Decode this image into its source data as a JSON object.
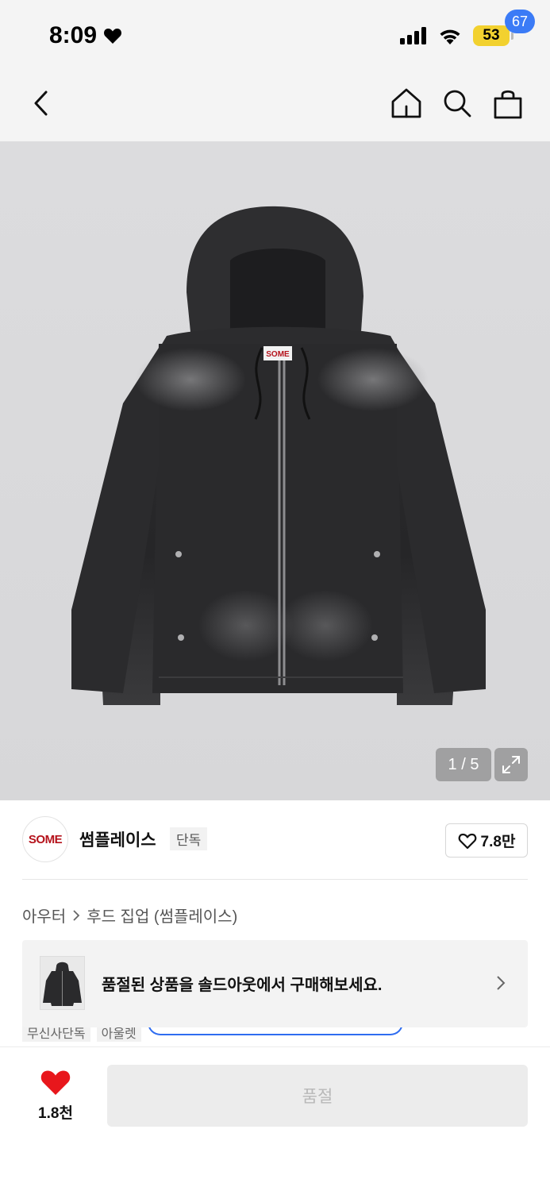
{
  "status_bar": {
    "time": "8:09",
    "battery": "53"
  },
  "nav": {
    "cart_count": "67"
  },
  "gallery": {
    "counter": "1 / 5",
    "label_on_garment": "SOME"
  },
  "brand": {
    "logo_text": "SOME",
    "name": "썸플레이스",
    "tag": "단독",
    "likes": "7.8만"
  },
  "breadcrumb": {
    "category": "아우터",
    "subcategory": "후드 집업 (썸플레이스)"
  },
  "banner": {
    "text": "품절된 상품을 솔드아웃에서 구매해보세요."
  },
  "partial_tags": [
    "무신사단독",
    "아울렛"
  ],
  "bottom": {
    "wish_count": "1.8천",
    "buy_label": "품절"
  },
  "colors": {
    "accent_blue": "#3b7bf6",
    "heart_red": "#e8171c",
    "brand_red": "#b5121b"
  }
}
